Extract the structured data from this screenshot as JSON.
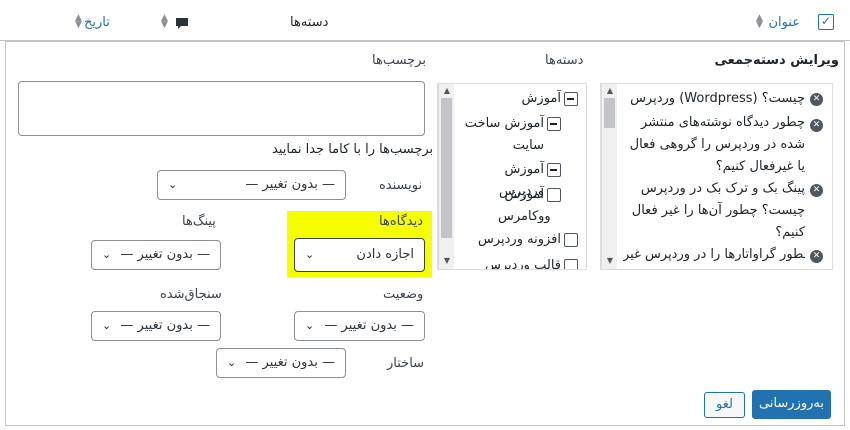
{
  "header": {
    "title_col": "عنوان",
    "categories_col": "دسته‌ها",
    "comments_icon": "comment-bubble-icon",
    "date_col": "تاریخ"
  },
  "bulk_edit": {
    "section_title": "ویرایش دسته‌جمعی",
    "titles": [
      "وردپرس (Wordpress) چیست؟",
      "چطور دیدگاه نوشته‌های منتشر شده در وردپرس را گروهی فعال یا غیرفعال کنیم؟",
      "پینگ بک و ترک بک در وردپرس چیست؟ چطور آن‌ها را غیر فعال کنیم؟",
      "چطور گراواتارها را در وردپرس غیر"
    ],
    "categories_label": "دسته‌ها",
    "categories": [
      {
        "label": "آموزش",
        "state": "indeterminate"
      },
      {
        "label": "آموزش ساخت سایت",
        "state": "indeterminate"
      },
      {
        "label": "آموزش وردپرس",
        "state": "indeterminate"
      },
      {
        "label": "آموزش ووکامرس",
        "state": "unchecked"
      },
      {
        "label": "افزونه وردپرس",
        "state": "unchecked"
      },
      {
        "label": "قالب وردپرس",
        "state": "unchecked"
      }
    ],
    "tags_label": "برچسب‌ها",
    "tags_value": "",
    "tags_hint": "برچسب‌ها را با کاما جدا نمایید",
    "author_label": "نویسنده",
    "author_value": "— بدون تغییر —",
    "comments_label": "دیدگاه‌ها",
    "comments_value": "اجازه دادن",
    "pings_label": "پینگ‌ها",
    "pings_value": "— بدون تغییر —",
    "status_label": "وضعیت",
    "status_value": "— بدون تغییر —",
    "sticky_label": "سنجاق‌شده",
    "sticky_value": "— بدون تغییر —",
    "format_label": "ساختار",
    "format_value": "— بدون تغییر —",
    "update_button": "به‌روزرسانی",
    "cancel_button": "لغو"
  },
  "colors": {
    "accent": "#2271b1",
    "highlight": "#f5ff00"
  }
}
